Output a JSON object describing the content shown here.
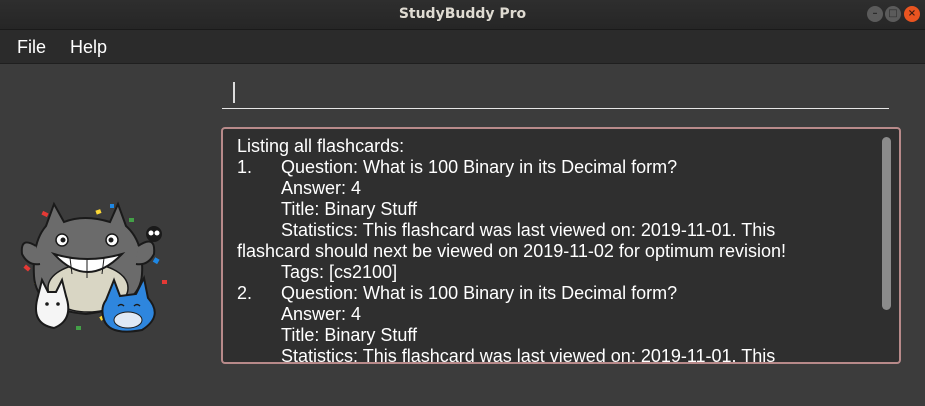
{
  "window": {
    "title": "StudyBuddy Pro"
  },
  "menu": {
    "file": "File",
    "help": "Help"
  },
  "command": {
    "value": "",
    "placeholder": ""
  },
  "result": {
    "header": "Listing all flashcards:",
    "cards": [
      {
        "number": "1.",
        "question": "Question: What is 100 Binary in its Decimal form?",
        "answer": "Answer: 4",
        "title": "Title: Binary Stuff",
        "statistics_line1": "Statistics: This flashcard was last viewed on: 2019-11-01. This",
        "statistics_line2": "flashcard should next be viewed on 2019-11-02 for optimum revision!",
        "tags": "Tags: [cs2100]"
      },
      {
        "number": "2.",
        "question": "Question: What is 100 Binary in its Decimal form?",
        "answer": "Answer: 4",
        "title": "Title: Binary Stuff",
        "statistics_line1": "Statistics: This flashcard was last viewed on: 2019-11-01. This"
      }
    ]
  },
  "colors": {
    "accent": "#e95420",
    "result_border": "#b88a8a",
    "background": "#3c3c3c"
  },
  "icons": {
    "mascot": "totoro-mascot-image"
  }
}
